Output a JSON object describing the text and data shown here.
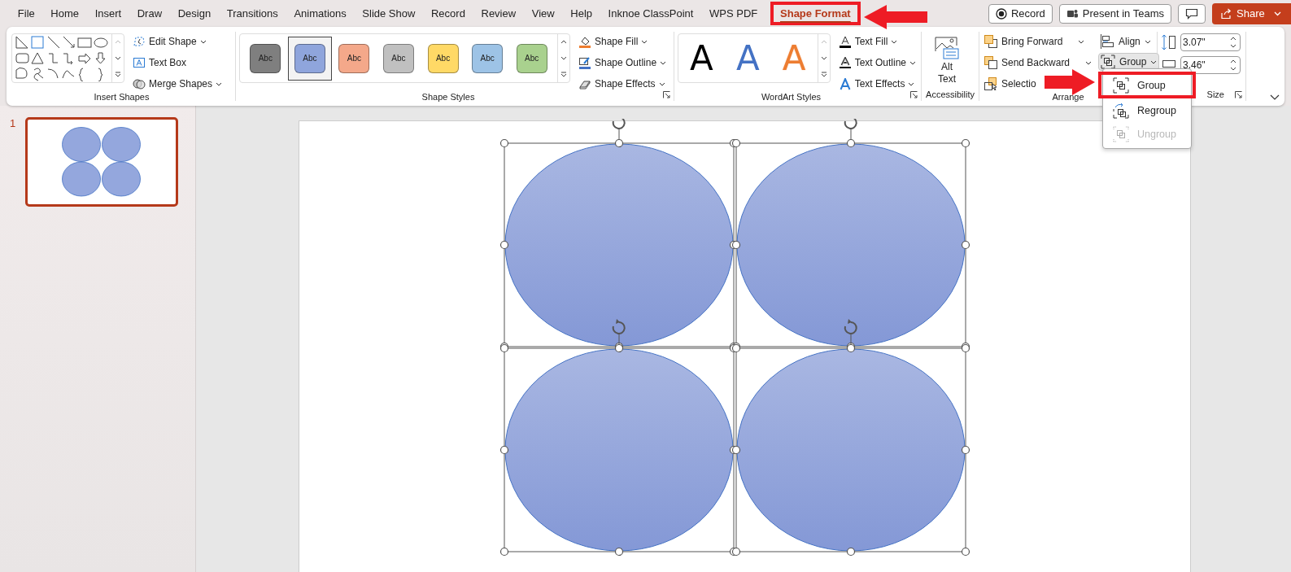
{
  "tabs": [
    {
      "label": "File",
      "selected": false
    },
    {
      "label": "Home",
      "selected": false
    },
    {
      "label": "Insert",
      "selected": false
    },
    {
      "label": "Draw",
      "selected": false
    },
    {
      "label": "Design",
      "selected": false
    },
    {
      "label": "Transitions",
      "selected": false
    },
    {
      "label": "Animations",
      "selected": false
    },
    {
      "label": "Slide Show",
      "selected": false
    },
    {
      "label": "Record",
      "selected": false
    },
    {
      "label": "Review",
      "selected": false
    },
    {
      "label": "View",
      "selected": false
    },
    {
      "label": "Help",
      "selected": false
    },
    {
      "label": "Inknoe ClassPoint",
      "selected": false
    },
    {
      "label": "WPS PDF",
      "selected": false
    },
    {
      "label": "Shape Format",
      "selected": true,
      "highlighted": true
    }
  ],
  "title_buttons": {
    "record": "Record",
    "present": "Present in Teams",
    "share": "Share"
  },
  "ribbon": {
    "insert_shapes": {
      "commands": [
        "Edit Shape",
        "Text Box",
        "Merge Shapes"
      ],
      "label": "Insert Shapes"
    },
    "shape_styles": {
      "swatches": [
        {
          "text": "Abc",
          "color": "#7f7f7f",
          "selected": false
        },
        {
          "text": "Abc",
          "color": "#8fa5dc",
          "selected": true
        },
        {
          "text": "Abc",
          "color": "#f4a88a",
          "selected": false
        },
        {
          "text": "Abc",
          "color": "#c0c0c0",
          "selected": false
        },
        {
          "text": "Abc",
          "color": "#ffd966",
          "selected": false
        },
        {
          "text": "Abc",
          "color": "#9dc3e6",
          "selected": false
        },
        {
          "text": "Abc",
          "color": "#a9d18e",
          "selected": false
        }
      ],
      "commands": [
        "Shape Fill",
        "Shape Outline",
        "Shape Effects"
      ],
      "label": "Shape Styles"
    },
    "wordart_styles": {
      "samples": [
        {
          "text": "A",
          "kind": "fill",
          "color": "#000000"
        },
        {
          "text": "A",
          "kind": "fill",
          "color": "#4472c4"
        },
        {
          "text": "A",
          "kind": "outline",
          "color": "#ed7d31"
        }
      ],
      "commands": [
        "Text Fill",
        "Text Outline",
        "Text Effects"
      ],
      "label": "WordArt Styles"
    },
    "accessibility": {
      "button": "Alt Text",
      "label": "Accessibility"
    },
    "arrange": {
      "commands": [
        "Bring Forward",
        "Send Backward",
        "Selectio"
      ],
      "align": "Align",
      "group": "Group",
      "label": "Arrange"
    },
    "size": {
      "height": "3.07\"",
      "width": "3.46\"",
      "label": "Size"
    }
  },
  "group_menu": [
    {
      "label": "Group",
      "disabled": false,
      "highlighted": true
    },
    {
      "label": "Regroup",
      "disabled": false,
      "highlighted": false
    },
    {
      "label": "Ungroup",
      "disabled": true,
      "highlighted": false
    }
  ],
  "slides": [
    {
      "number": "1",
      "selected": true
    }
  ]
}
